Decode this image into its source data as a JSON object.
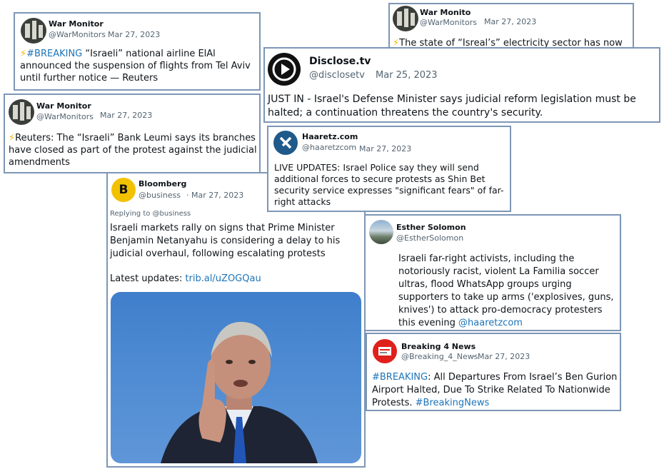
{
  "tweets": {
    "war1": {
      "name": "War Monitor",
      "handle": "@WarMonitors",
      "date": "Mar 27, 2023",
      "emoji": "⚡",
      "hashtag": "#BREAKING",
      "text": " “Israeli” national airline ElAl announced the suspension of flights from Tel Aviv until further notice — Reuters"
    },
    "war2": {
      "name": "War Monito",
      "handle": "@WarMonitors",
      "date": "Mar 27, 2023",
      "emoji": "⚡",
      "text": "The state of “Isreal’s” electricity sector has now gone on strike"
    },
    "disclose": {
      "name": "Disclose.tv",
      "handle": "@disclosetv",
      "date": "Mar 25, 2023",
      "text": "JUST IN - Israel's Defense Minister says judicial reform legislation must be halted; a continuation threatens the country's security."
    },
    "war3": {
      "name": "War Monitor",
      "handle": "@WarMonitors",
      "date": "Mar 27, 2023",
      "emoji": "⚡",
      "text": "Reuters: The “Israeli” Bank Leumi says its branches have closed as part of the protest against the judicial amendments"
    },
    "haaretz": {
      "name": "Haaretz.com",
      "handle": "@haaretzcom",
      "date": "Mar 27, 2023",
      "text": "LIVE UPDATES: Israel Police say they will send additional forces to secure protests as Shin Bet security service expresses \"significant fears\" of far-right attacks"
    },
    "bloomberg": {
      "name": "Bloomberg",
      "handle": "@business",
      "date": "Mar 27, 2023",
      "replying": "Replying to @business",
      "text": "Israeli markets rally on signs that Prime Minister Benjamin Netanyahu is considering a delay to his judicial overhaul, following escalating protests",
      "updates_label": "Latest updates: ",
      "updates_link": "trib.al/uZOGQau",
      "avatar_letter": "B"
    },
    "esther": {
      "name": "Esther Solomon",
      "handle": "@EstherSolomon",
      "text": "Israeli far-right activists, including the notoriously racist, violent La Familia soccer ultras, flood WhatsApp groups urging supporters to take up arms ('explosives, guns, knives') to attack pro-democracy protesters this evening ",
      "mention": "@haaretzcom"
    },
    "breaking4": {
      "name": "Breaking 4 News",
      "handle": "@Breaking_4_News",
      "date": "Mar 27, 2023",
      "hashtag": "#BREAKING",
      "text": ": All Departures From Israel’s Ben Gurion Airport Halted, Due To Strike Related To Nationwide Protests. ",
      "hashtag2": "#BreakingNews"
    }
  },
  "separator": "·"
}
